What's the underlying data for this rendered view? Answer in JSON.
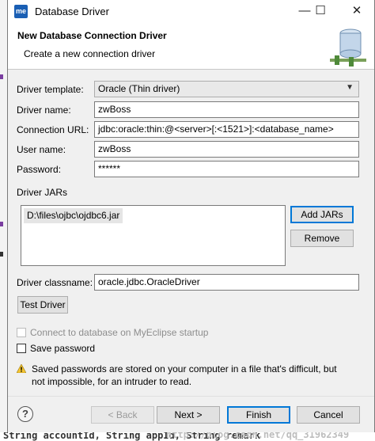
{
  "window": {
    "title": "Database Driver",
    "app_icon_text": "me",
    "minimize": "—",
    "maximize": "☐",
    "close": "✕"
  },
  "header": {
    "title": "New Database Connection Driver",
    "subtitle": "Create a new connection driver"
  },
  "form": {
    "template_label": "Driver template:",
    "template_value": "Oracle (Thin driver)",
    "name_label": "Driver name:",
    "name_value": "zwBoss",
    "url_label": "Connection URL:",
    "url_value": "jdbc:oracle:thin:@<server>[:<1521>]:<database_name>",
    "user_label": "User name:",
    "user_value": "zwBoss",
    "password_label": "Password:",
    "password_value": "******"
  },
  "jars": {
    "group_label": "Driver JARs",
    "items": [
      "D:\\files\\ojbc\\ojdbc6.jar"
    ],
    "add_label": "Add JARs",
    "remove_label": "Remove"
  },
  "classname": {
    "label": "Driver classname:",
    "value": "oracle.jdbc.OracleDriver"
  },
  "test_driver_label": "Test Driver",
  "options": {
    "connect_startup": "Connect to database on MyEclipse startup",
    "save_password": "Save password"
  },
  "warning": "Saved passwords are stored on your computer in a file that's difficult, but not impossible, for an intruder to read.",
  "footer": {
    "help": "?",
    "back": "< Back",
    "next": "Next >",
    "finish": "Finish",
    "cancel": "Cancel"
  },
  "background": {
    "code_text": "String accountId, String appId, String remark",
    "watermark": "http://blog.csdn.net/qq_31962349"
  },
  "colors": {
    "accent": "#0078d7",
    "app_icon": "#1a5fb4",
    "dialog_bg": "#f0f0f0"
  }
}
